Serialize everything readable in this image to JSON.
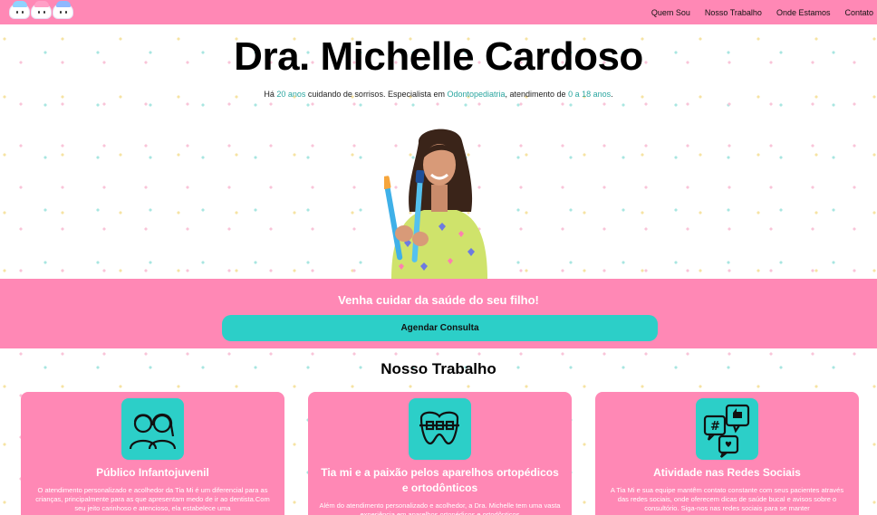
{
  "nav": {
    "links": [
      "Quem Sou",
      "Nosso Trabalho",
      "Onde Estamos",
      "Contato"
    ],
    "logo": {
      "icon": "tooth-characters-logo",
      "colors": [
        "#8fd3ff",
        "#ff9fc6",
        "#8fb8ff"
      ]
    }
  },
  "hero": {
    "title": "Dra. Michelle Cardoso",
    "subtitle_parts": [
      "Há ",
      "20 anos",
      " cuidando de sorrisos. Especialista em ",
      "Odontopediatria",
      ", atendimento de ",
      "0 a 18 anos",
      "."
    ],
    "photo": "dentist-portrait"
  },
  "cta": {
    "title": "Venha cuidar da saúde do seu filho!",
    "button": "Agendar Consulta"
  },
  "work": {
    "title": "Nosso Trabalho",
    "cards": [
      {
        "icon": "children-icon",
        "title": "Público Infantojuvenil",
        "text": "O atendimento personalizado e acolhedor da Tia Mi é um diferencial para as crianças, principalmente para as que apresentam medo de ir ao dentista.Com seu jeito carinhoso e atencioso, ela estabelece uma"
      },
      {
        "icon": "braces-teeth-icon",
        "title": "Tia mi e a paixão pelos aparelhos ortopédicos e ortodônticos",
        "text": "Além do atendimento personalizado e acolhedor, a Dra. Michelle tem uma vasta experiência em aparelhos ortopédicos e ortodônticos"
      },
      {
        "icon": "social-media-icon",
        "title": "Atividade nas Redes Sociais",
        "text": "A Tia Mi e sua equipe mantêm contato constante com seus pacientes através das redes sociais, onde oferecem dicas de saúde bucal e avisos sobre o consultório. Siga-nos nas redes sociais para se manter"
      }
    ]
  },
  "colors": {
    "pink": "#ff88b5",
    "teal": "#2ccfc8",
    "highlight": "#2ba6a0"
  }
}
